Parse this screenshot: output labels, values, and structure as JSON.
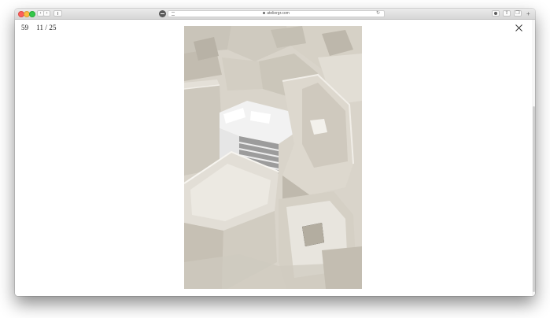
{
  "browser": {
    "url": "ateliergr.com",
    "back_glyph": "‹",
    "forward_glyph": "›",
    "reload_glyph": "↻",
    "new_tab_glyph": "+",
    "icons": [
      "lock-icon",
      "reload-icon",
      "download-icon",
      "share-icon",
      "tabs-icon",
      "sidebar-icon",
      "shield-icon",
      "reader-icon"
    ]
  },
  "gallery": {
    "project_number": "59",
    "position": "11 / 25",
    "photo_subject": "model-photo",
    "close_icon": "close-icon"
  },
  "colors": {
    "traffic_close": "#fc605c",
    "traffic_minimize": "#fdbc40",
    "traffic_maximize": "#34c84a",
    "page_background": "#ffffff",
    "model_cardboard": "#d8d3c8"
  }
}
